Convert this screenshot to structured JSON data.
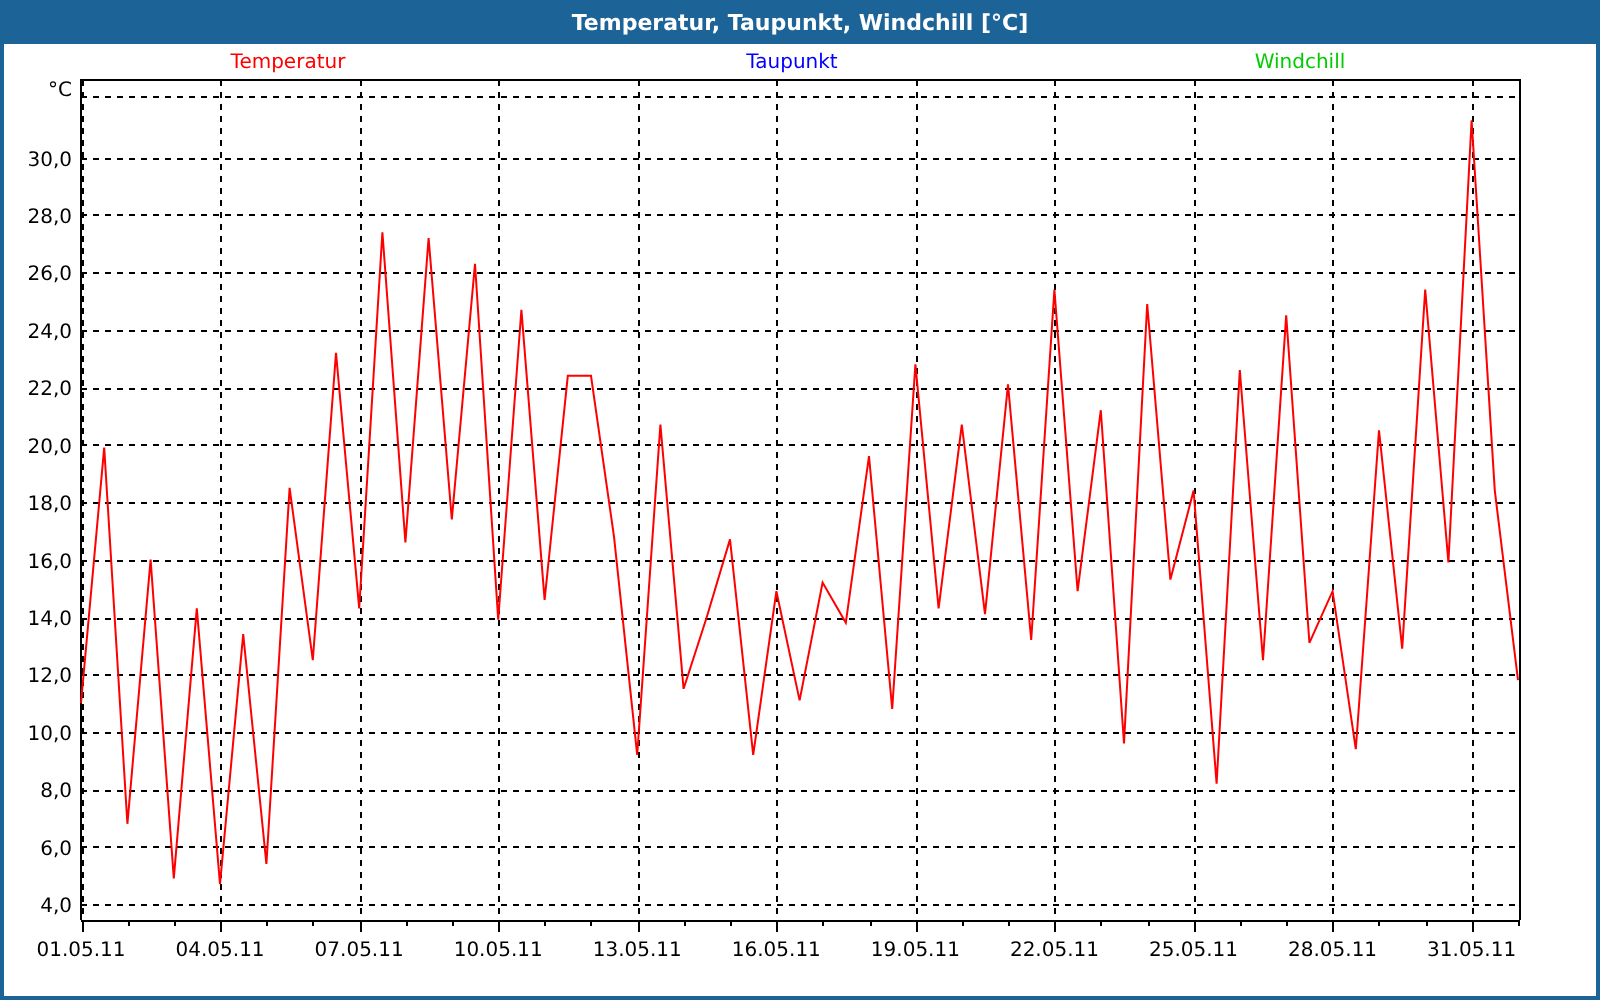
{
  "window": {
    "title": "Temperatur, Taupunkt, Windchill [°C]"
  },
  "chart": {
    "chart_data": {
      "type": "line",
      "grid": true,
      "ylabel": "°C",
      "ylim": [
        3.45,
        32.7
      ],
      "categories": [
        "01.05.11",
        null,
        null,
        null,
        null,
        null,
        "04.05.11",
        null,
        null,
        null,
        null,
        null,
        "07.05.11",
        null,
        null,
        null,
        null,
        null,
        "10.05.11",
        null,
        null,
        null,
        null,
        null,
        "13.05.11",
        null,
        null,
        null,
        null,
        null,
        "16.05.11",
        null,
        null,
        null,
        null,
        null,
        "19.05.11",
        null,
        null,
        null,
        null,
        null,
        "22.05.11",
        null,
        null,
        null,
        null,
        null,
        "25.05.11",
        null,
        null,
        null,
        null,
        null,
        "28.05.11",
        null,
        null,
        null,
        null,
        null,
        "31.05.11",
        null,
        null
      ],
      "series": [
        {
          "name": "Temperatur",
          "color": "#ff0000",
          "values": [
            11,
            19.9,
            6.8,
            16,
            4.9,
            14.3,
            4.7,
            13.4,
            5.4,
            18.5,
            12.5,
            23.2,
            14.3,
            27.4,
            16.6,
            27.2,
            17.4,
            26.3,
            13.9,
            24.7,
            14.6,
            22.4,
            22.4,
            16.8,
            9.2,
            20.7,
            11.5,
            14,
            16.7,
            9.2,
            14.9,
            11.1,
            15.2,
            13.8,
            19.6,
            10.8,
            22.8,
            14.3,
            20.7,
            14.1,
            22.1,
            13.2,
            25.4,
            14.9,
            21.2,
            9.6,
            24.9,
            15.3,
            18.4,
            8.2,
            22.6,
            12.5,
            24.5,
            13.1,
            14.9,
            9.4,
            20.5,
            12.9,
            25.4,
            15.9,
            31.3,
            18.4,
            11.8
          ]
        },
        {
          "name": "Taupunkt",
          "color": "#0000ff",
          "values": [
            null,
            null,
            null,
            null,
            null,
            null,
            null,
            null,
            null,
            null,
            null,
            null,
            null,
            null,
            null,
            null,
            null,
            null,
            null,
            null,
            null,
            null,
            null,
            null,
            null,
            null,
            null,
            null,
            null,
            null,
            null,
            null,
            null,
            null,
            null,
            null,
            null,
            null,
            null,
            null,
            null,
            null,
            null,
            null,
            null,
            null,
            null,
            null,
            null,
            null,
            null,
            null,
            null,
            null,
            null,
            null,
            null,
            null,
            null,
            null,
            null,
            null,
            null
          ]
        },
        {
          "name": "Windchill",
          "color": "#00cc00",
          "values": [
            null,
            null,
            null,
            null,
            null,
            null,
            null,
            null,
            null,
            null,
            null,
            null,
            null,
            null,
            null,
            null,
            null,
            null,
            null,
            null,
            null,
            null,
            null,
            null,
            null,
            null,
            null,
            null,
            null,
            null,
            null,
            null,
            null,
            null,
            null,
            null,
            null,
            null,
            null,
            null,
            null,
            null,
            null,
            null,
            null,
            null,
            null,
            null,
            null,
            null,
            null,
            null,
            null,
            null,
            null,
            null,
            null,
            null,
            null,
            null,
            null,
            null,
            null
          ]
        }
      ],
      "yticks": [
        {
          "value": 4,
          "label": "4,0"
        },
        {
          "value": 6,
          "label": "6,0"
        },
        {
          "value": 8,
          "label": "8,0"
        },
        {
          "value": 10,
          "label": "10,0"
        },
        {
          "value": 12,
          "label": "12,0"
        },
        {
          "value": 14,
          "label": "14,0"
        },
        {
          "value": 16,
          "label": "16,0"
        },
        {
          "value": 18,
          "label": "18,0"
        },
        {
          "value": 20,
          "label": "20,0"
        },
        {
          "value": 22,
          "label": "22,0"
        },
        {
          "value": 24,
          "label": "24,0"
        },
        {
          "value": 26,
          "label": "26,0"
        },
        {
          "value": 28,
          "label": "28,0"
        },
        {
          "value": 30,
          "label": "30,0"
        }
      ]
    }
  }
}
